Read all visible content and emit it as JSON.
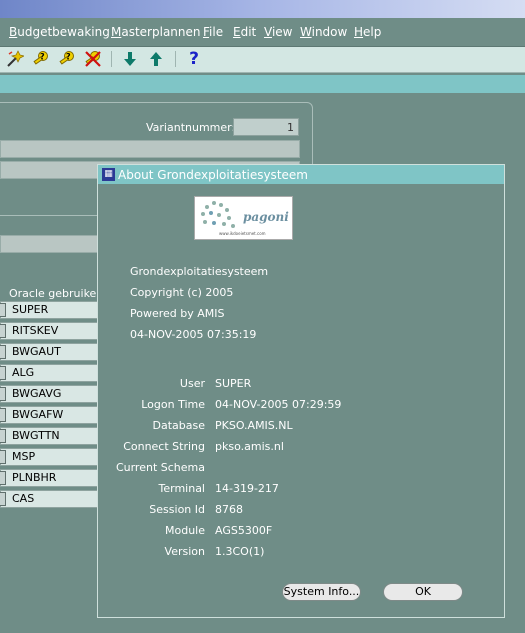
{
  "menubar": {
    "items": [
      {
        "label": "Budgetbewaking",
        "mnemonic": "B",
        "rest": "udgetbewaking"
      },
      {
        "label": "Masterplannen",
        "mnemonic": "M",
        "rest": "asterplannen"
      },
      {
        "label": "File",
        "mnemonic": "F",
        "rest": "ile"
      },
      {
        "label": "Edit",
        "mnemonic": "E",
        "rest": "dit"
      },
      {
        "label": "View",
        "mnemonic": "V",
        "rest": "iew"
      },
      {
        "label": "Window",
        "mnemonic": "W",
        "rest": "indow"
      },
      {
        "label": "Help",
        "mnemonic": "H",
        "rest": "elp"
      }
    ]
  },
  "toolbar": {
    "icons": [
      "wand-icon",
      "key-help-icon",
      "key-query-icon",
      "delete-record-icon",
      "arrow-down-icon",
      "arrow-up-icon",
      "help-icon"
    ],
    "help_glyph": "?"
  },
  "form": {
    "variant_label": "Variantnummer:",
    "variant_value": "1",
    "users_label": "Oracle gebruikersn",
    "users": [
      "SUPER",
      "RITSKEV",
      "BWGAUT",
      "ALG",
      "BWGAVG",
      "BWGAFW",
      "BWGTTN",
      "MSP",
      "PLNBHR",
      "CAS"
    ]
  },
  "dialog": {
    "title": "About Grondexploitatiesysteem",
    "logo_text": "pagoni",
    "logo_small": "www.ikdoeietsmet.com",
    "app_name": "Grondexploitatiesysteem",
    "copyright": "Copyright (c) 2005",
    "powered_by": "Powered by AMIS",
    "build_date": "04-NOV-2005 07:35:19",
    "details": [
      {
        "label": "User",
        "value": "SUPER"
      },
      {
        "label": "Logon Time",
        "value": "04-NOV-2005 07:29:59"
      },
      {
        "label": "Database",
        "value": "PKSO.AMIS.NL"
      },
      {
        "label": "Connect String",
        "value": "pkso.amis.nl"
      },
      {
        "label": "Current Schema",
        "value": ""
      },
      {
        "label": "Terminal",
        "value": "14-319-217"
      },
      {
        "label": "Session Id",
        "value": "8768"
      },
      {
        "label": "Module",
        "value": "AGS5300F"
      },
      {
        "label": "Version",
        "value": "1.3CO(1)"
      }
    ],
    "system_info_button": "System Info...",
    "ok_button": "OK"
  },
  "colors": {
    "background": "#6f8d87",
    "accent_strip": "#7fc5c6",
    "toolbar": "#d3e7e3"
  }
}
